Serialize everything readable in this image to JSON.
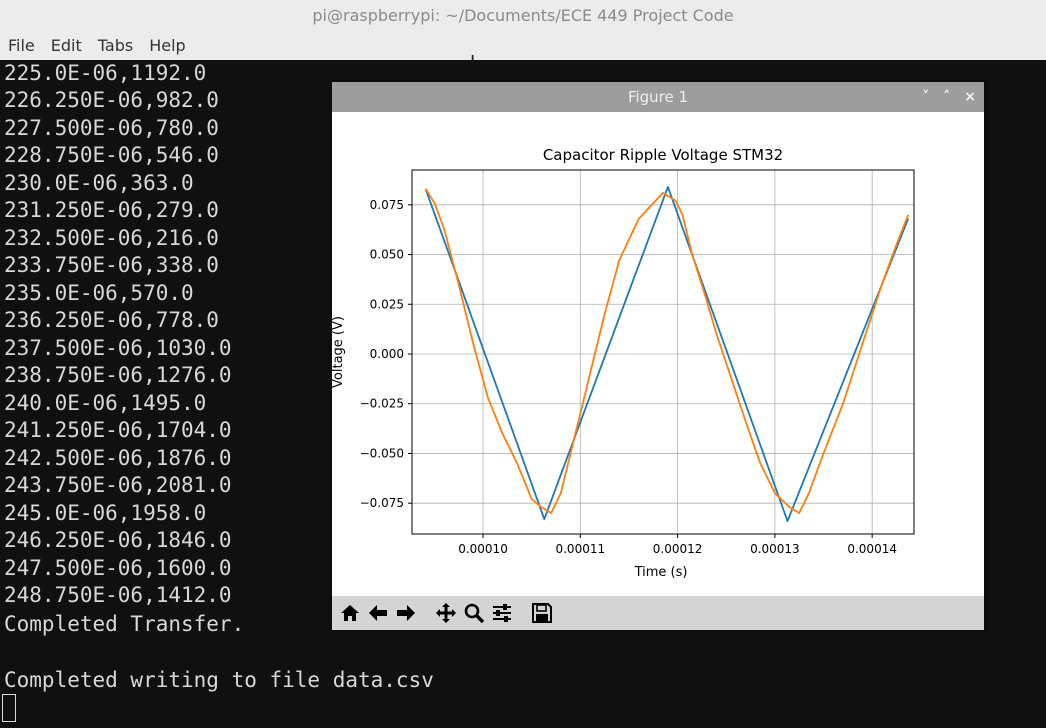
{
  "window": {
    "title": "pi@raspberrypi: ~/Documents/ECE 449 Project Code"
  },
  "menu": [
    "File",
    "Edit",
    "Tabs",
    "Help"
  ],
  "terminal": {
    "lines": [
      "225.0E-06,1192.0",
      "226.250E-06,982.0",
      "227.500E-06,780.0",
      "228.750E-06,546.0",
      "230.0E-06,363.0",
      "231.250E-06,279.0",
      "232.500E-06,216.0",
      "233.750E-06,338.0",
      "235.0E-06,570.0",
      "236.250E-06,778.0",
      "237.500E-06,1030.0",
      "238.750E-06,1276.0",
      "240.0E-06,1495.0",
      "241.250E-06,1704.0",
      "242.500E-06,1876.0",
      "243.750E-06,2081.0",
      "245.0E-06,1958.0",
      "246.250E-06,1846.0",
      "247.500E-06,1600.0",
      "248.750E-06,1412.0",
      "Completed Transfer.",
      "",
      "Completed writing to file data.csv"
    ]
  },
  "figure": {
    "window_title": "Figure 1",
    "controls": {
      "minimize": "˅",
      "maximize": "˄",
      "close": "×"
    },
    "toolbar": [
      "home-icon",
      "back-icon",
      "forward-icon",
      "pan-icon",
      "zoom-icon",
      "configure-icon",
      "save-icon"
    ]
  },
  "chart_data": {
    "type": "line",
    "title": "Capacitor Ripple Voltage STM32",
    "xlabel": "Time (s)",
    "ylabel": "Voltage (V)",
    "xlim": [
      9.27e-05,
      0.0001443
    ],
    "ylim": [
      -0.0905,
      0.0925
    ],
    "xticks": [
      0.0001,
      0.00011,
      0.00012,
      0.00013,
      0.00014
    ],
    "xtick_labels": [
      "0.00010",
      "0.00011",
      "0.00012",
      "0.00013",
      "0.00014"
    ],
    "yticks": [
      -0.075,
      -0.05,
      -0.025,
      0.0,
      0.025,
      0.05,
      0.075
    ],
    "ytick_labels": [
      "−0.075",
      "−0.050",
      "−0.025",
      "0.000",
      "0.025",
      "0.050",
      "0.075"
    ],
    "grid": true,
    "series": [
      {
        "color": "#1f77b4",
        "x": [
          9.41e-05,
          0.0001063,
          0.000119,
          0.0001313,
          0.0001437
        ],
        "y": [
          0.083,
          -0.083,
          0.084,
          -0.084,
          0.068
        ]
      },
      {
        "color": "#ff7f0e",
        "x": [
          9.41e-05,
          9.5e-05,
          9.6e-05,
          9.75e-05,
          9.9e-05,
          0.0001005,
          0.000102,
          0.0001035,
          0.000105,
          0.000106,
          0.000107,
          0.000108,
          0.0001095,
          0.000111,
          0.0001125,
          0.000114,
          0.000116,
          0.0001185,
          0.0001198,
          0.0001205,
          0.0001215,
          0.0001228,
          0.000124,
          0.0001255,
          0.000127,
          0.0001285,
          0.00013,
          0.0001315,
          0.0001325,
          0.0001335,
          0.000135,
          0.000137,
          0.000139,
          0.000141,
          0.0001425,
          0.0001437
        ],
        "y": [
          0.083,
          0.076,
          0.063,
          0.035,
          0.005,
          -0.022,
          -0.04,
          -0.055,
          -0.073,
          -0.077,
          -0.08,
          -0.07,
          -0.04,
          -0.01,
          0.02,
          0.047,
          0.068,
          0.081,
          0.077,
          0.07,
          0.05,
          0.03,
          0.01,
          -0.012,
          -0.034,
          -0.055,
          -0.07,
          -0.077,
          -0.08,
          -0.07,
          -0.05,
          -0.025,
          0.005,
          0.035,
          0.055,
          0.07
        ]
      }
    ]
  }
}
